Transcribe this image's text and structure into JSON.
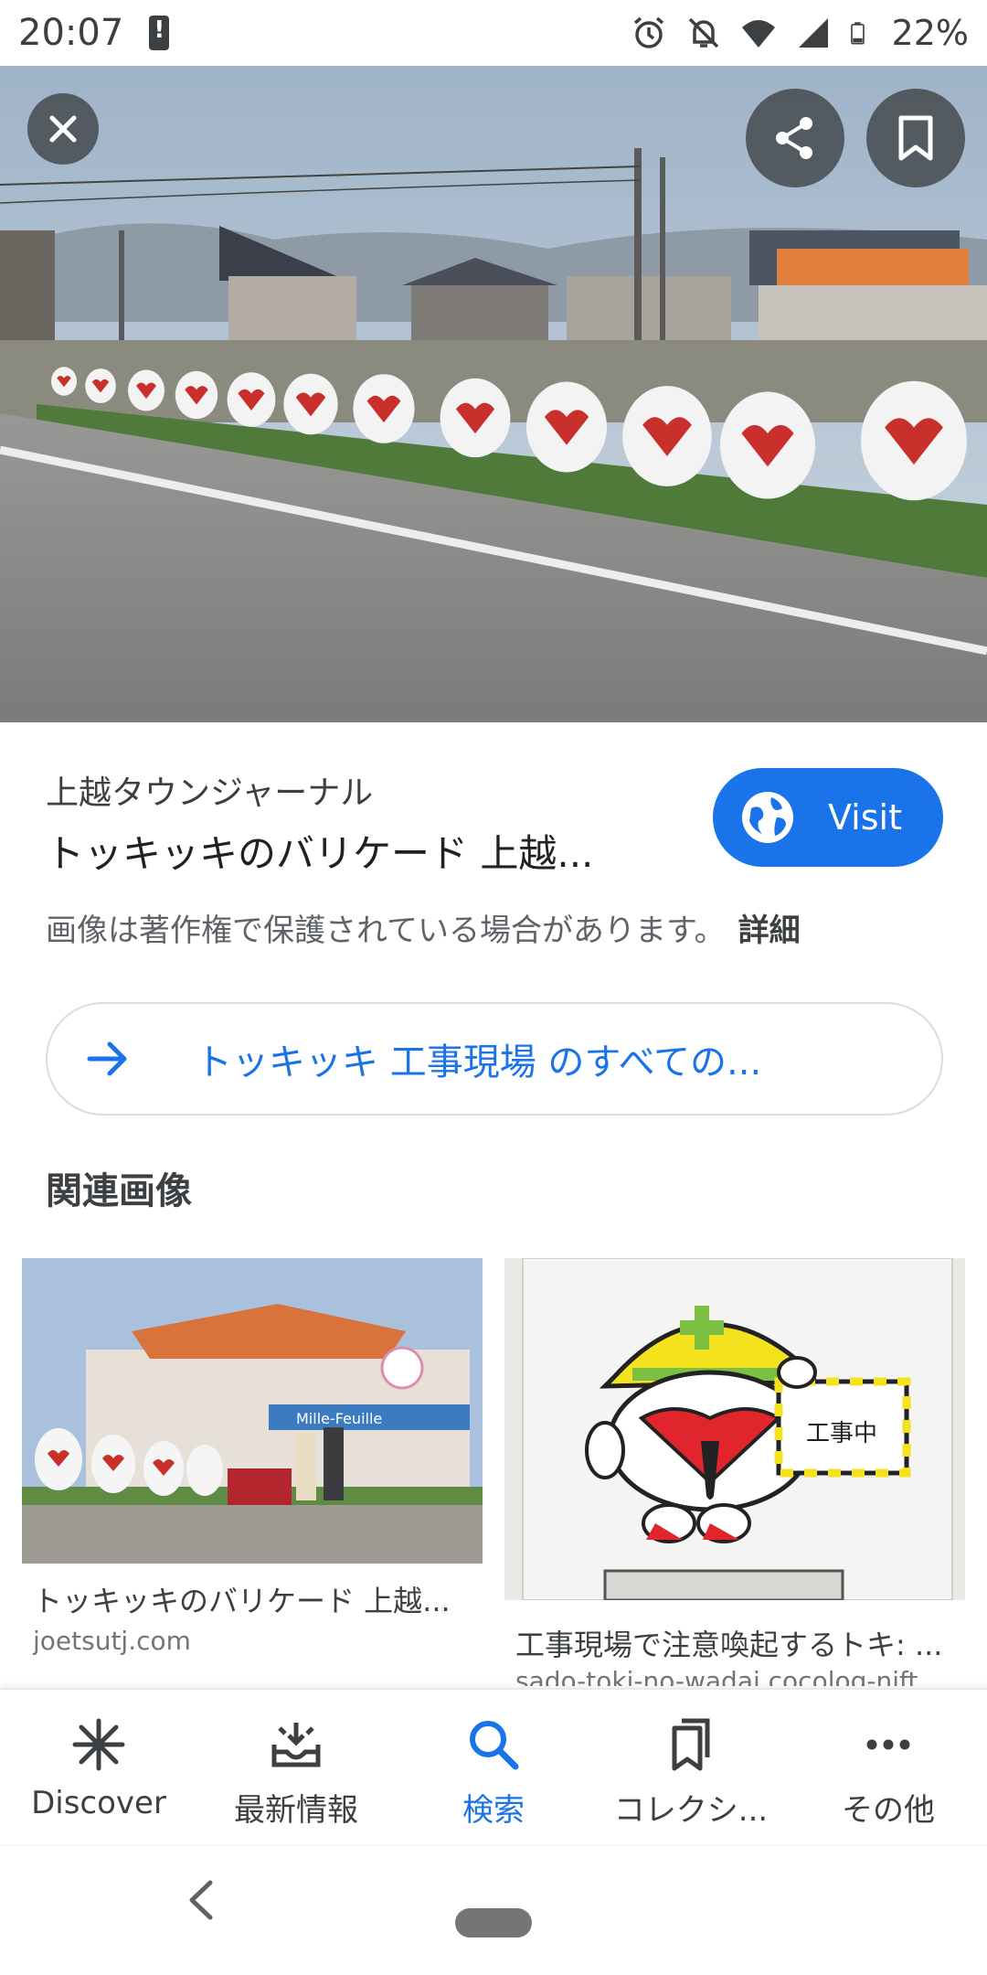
{
  "status_bar": {
    "time": "20:07",
    "battery": "22%",
    "icons": [
      "alert-icon",
      "alarm-icon",
      "notifications-off-icon",
      "wifi-icon",
      "signal-icon",
      "battery-icon"
    ]
  },
  "viewer": {
    "hero_icons": [
      "close-icon",
      "share-icon",
      "bookmark-icon"
    ],
    "source": "上越タウンジャーナル",
    "title": "トッキッキのバリケード 上越...",
    "visit_label": "Visit",
    "copyright_text": "画像は著作権で保護されている場合があります。",
    "copyright_link": "詳細",
    "all_results_label": "トッキッキ 工事現場 のすべての...",
    "related_heading": "関連画像",
    "related": [
      {
        "caption": "トッキッキのバリケード 上越...",
        "domain": "joetsutj.com",
        "photo_text": "Mille-Feuille"
      },
      {
        "caption": "工事現場で注意喚起するトキ: ...",
        "domain": "sado-toki-no-wadai.cocolog-nift...",
        "sign_text": "工事中"
      }
    ]
  },
  "bottom_nav": {
    "items": [
      {
        "label": "Discover",
        "icon": "asterisk-icon",
        "active": false
      },
      {
        "label": "最新情報",
        "icon": "updates-tray-icon",
        "active": false
      },
      {
        "label": "検索",
        "icon": "search-icon",
        "active": true
      },
      {
        "label": "コレクシ...",
        "icon": "collections-icon",
        "active": false
      },
      {
        "label": "その他",
        "icon": "more-dots-icon",
        "active": false
      }
    ]
  },
  "colors": {
    "accent": "#1a73e8",
    "text_primary": "#202124",
    "text_secondary": "#5f6368"
  }
}
